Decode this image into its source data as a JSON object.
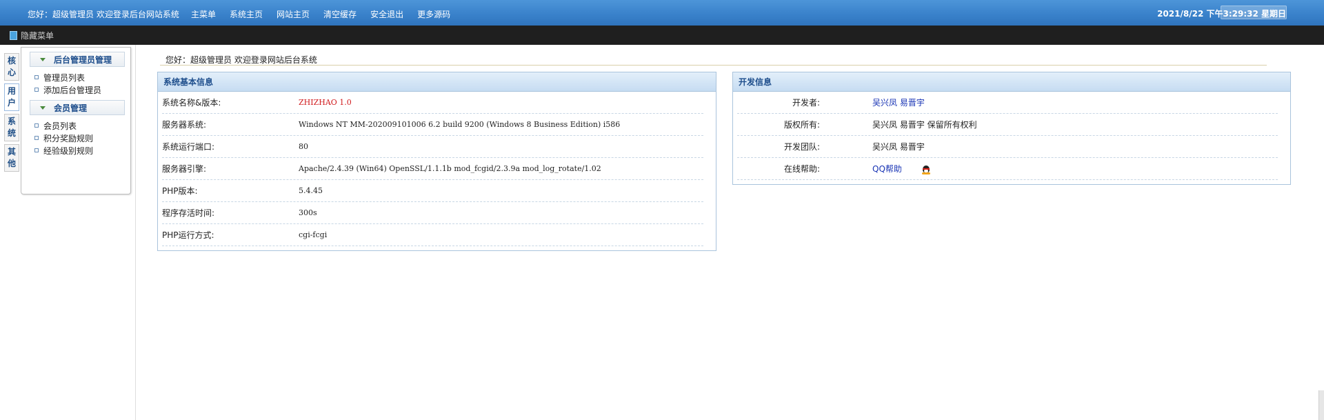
{
  "topbar": {
    "greeting": "您好：超级管理员 欢迎登录后台网站系统",
    "menu": [
      "主菜单",
      "系统主页",
      "网站主页",
      "清空缓存",
      "安全退出",
      "更多源码"
    ],
    "datetime": "2021/8/22 下午3:29:32 星期日"
  },
  "strip": {
    "hide_menu": "隐藏菜单"
  },
  "vtabs": [
    {
      "label": "核心",
      "chars": [
        "核",
        "心"
      ]
    },
    {
      "label": "用户",
      "chars": [
        "用",
        "户"
      ]
    },
    {
      "label": "系统",
      "chars": [
        "系",
        "统"
      ]
    },
    {
      "label": "其他",
      "chars": [
        "其",
        "他"
      ]
    }
  ],
  "sidebar": {
    "groups": [
      {
        "title": "后台管理员管理",
        "items": [
          "管理员列表",
          "添加后台管理员"
        ]
      },
      {
        "title": "会员管理",
        "items": [
          "会员列表",
          "积分奖励规则",
          "经验级别规则"
        ]
      }
    ]
  },
  "welcome": "您好：超级管理员   欢迎登录网站后台系统",
  "system_info": {
    "title": "系统基本信息",
    "rows": [
      {
        "label": "系统名称&版本:",
        "value": "ZHIZHAO 1.0"
      },
      {
        "label": "服务器系统:",
        "value": "Windows NT MM-202009101006 6.2 build 9200 (Windows 8 Business Edition) i586"
      },
      {
        "label": "系统运行端口:",
        "value": "80"
      },
      {
        "label": "服务器引擎:",
        "value": "Apache/2.4.39 (Win64) OpenSSL/1.1.1b mod_fcgid/2.3.9a mod_log_rotate/1.02"
      },
      {
        "label": "PHP版本:",
        "value": "5.4.45"
      },
      {
        "label": "程序存活时间:",
        "value": "300s"
      },
      {
        "label": "PHP运行方式:",
        "value": "cgi-fcgi"
      }
    ]
  },
  "dev_info": {
    "title": "开发信息",
    "developer_label": "开发者:",
    "developer_names": [
      "吴兴凤",
      "易晋宇"
    ],
    "copyright_label": "版权所有:",
    "copyright_value": "吴兴凤 易晋宇 保留所有权利",
    "team_label": "开发团队:",
    "team_value": "吴兴凤 易晋宇",
    "help_label": "在线帮助:",
    "help_link": "QQ帮助",
    "help_icon": "qq-penguin-icon"
  }
}
